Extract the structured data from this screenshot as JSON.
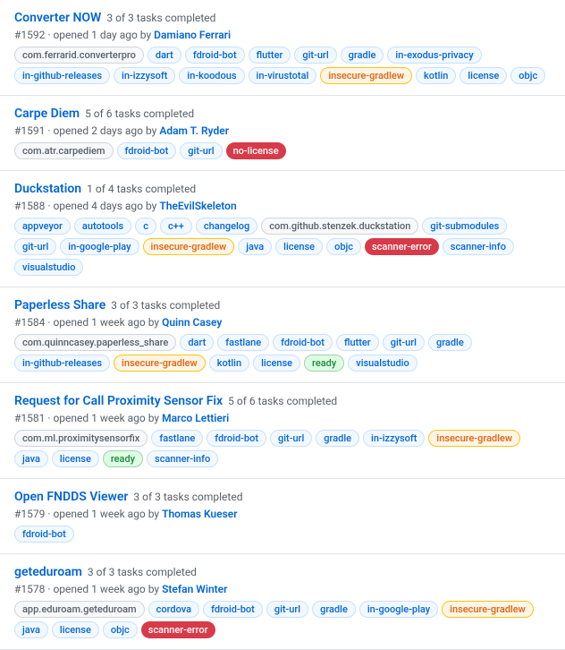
{
  "issues": [
    {
      "id": "converter-now",
      "title": "Converter NOW",
      "task_count": "3 of 3 tasks completed",
      "number": "#1592",
      "meta": "opened 1 day ago by",
      "author": "Damiano Ferrari",
      "tags": [
        {
          "label": "com.ferrarid.converterpro",
          "style": "gray"
        },
        {
          "label": "dart",
          "style": "light-blue"
        },
        {
          "label": "fdroid-bot",
          "style": "light-blue"
        },
        {
          "label": "flutter",
          "style": "light-blue"
        },
        {
          "label": "git-url",
          "style": "light-blue"
        },
        {
          "label": "gradle",
          "style": "light-blue"
        },
        {
          "label": "in-exodus-privacy",
          "style": "light-blue"
        },
        {
          "label": "in-github-releases",
          "style": "light-blue"
        },
        {
          "label": "in-izzysoft",
          "style": "light-blue"
        },
        {
          "label": "in-koodous",
          "style": "light-blue"
        },
        {
          "label": "in-virustotal",
          "style": "light-blue"
        },
        {
          "label": "insecure-gradlew",
          "style": "orange"
        },
        {
          "label": "kotlin",
          "style": "light-blue"
        },
        {
          "label": "license",
          "style": "light-blue"
        },
        {
          "label": "objc",
          "style": "light-blue"
        }
      ]
    },
    {
      "id": "carpe-diem",
      "title": "Carpe Diem",
      "task_count": "5 of 6 tasks completed",
      "number": "#1591",
      "meta": "opened 2 days ago by",
      "author": "Adam T. Ryder",
      "tags": [
        {
          "label": "com.atr.carpediem",
          "style": "gray"
        },
        {
          "label": "fdroid-bot",
          "style": "light-blue"
        },
        {
          "label": "git-url",
          "style": "light-blue"
        },
        {
          "label": "no-license",
          "style": "red"
        }
      ]
    },
    {
      "id": "duckstation",
      "title": "Duckstation",
      "task_count": "1 of 4 tasks completed",
      "number": "#1588",
      "meta": "opened 4 days ago by",
      "author": "TheEvilSkeleton",
      "tags": [
        {
          "label": "appveyor",
          "style": "light-blue"
        },
        {
          "label": "autotools",
          "style": "light-blue"
        },
        {
          "label": "c",
          "style": "light-blue"
        },
        {
          "label": "c++",
          "style": "light-blue"
        },
        {
          "label": "changelog",
          "style": "light-blue"
        },
        {
          "label": "com.github.stenzek.duckstation",
          "style": "gray"
        },
        {
          "label": "git-submodules",
          "style": "light-blue"
        },
        {
          "label": "git-url",
          "style": "light-blue"
        },
        {
          "label": "in-google-play",
          "style": "light-blue"
        },
        {
          "label": "insecure-gradlew",
          "style": "orange"
        },
        {
          "label": "java",
          "style": "light-blue"
        },
        {
          "label": "license",
          "style": "light-blue"
        },
        {
          "label": "objc",
          "style": "light-blue"
        },
        {
          "label": "scanner-error",
          "style": "red"
        },
        {
          "label": "scanner-info",
          "style": "light-blue"
        },
        {
          "label": "visualstudio",
          "style": "light-blue"
        }
      ]
    },
    {
      "id": "paperless-share",
      "title": "Paperless Share",
      "task_count": "3 of 3 tasks completed",
      "number": "#1584",
      "meta": "opened 1 week ago by",
      "author": "Quinn Casey",
      "tags": [
        {
          "label": "com.quinncasey.paperless_share",
          "style": "gray"
        },
        {
          "label": "dart",
          "style": "light-blue"
        },
        {
          "label": "fastlane",
          "style": "light-blue"
        },
        {
          "label": "fdroid-bot",
          "style": "light-blue"
        },
        {
          "label": "flutter",
          "style": "light-blue"
        },
        {
          "label": "git-url",
          "style": "light-blue"
        },
        {
          "label": "gradle",
          "style": "light-blue"
        },
        {
          "label": "in-github-releases",
          "style": "light-blue"
        },
        {
          "label": "insecure-gradlew",
          "style": "orange"
        },
        {
          "label": "kotlin",
          "style": "light-blue"
        },
        {
          "label": "license",
          "style": "light-blue"
        },
        {
          "label": "ready",
          "style": "green"
        },
        {
          "label": "visualstudio",
          "style": "light-blue"
        }
      ]
    },
    {
      "id": "request-call-proximity",
      "title": "Request for Call Proximity Sensor Fix",
      "task_count": "5 of 6 tasks completed",
      "number": "#1581",
      "meta": "opened 1 week ago by",
      "author": "Marco Lettieri",
      "tags": [
        {
          "label": "com.ml.proximitysensorfix",
          "style": "gray"
        },
        {
          "label": "fastlane",
          "style": "light-blue"
        },
        {
          "label": "fdroid-bot",
          "style": "light-blue"
        },
        {
          "label": "git-url",
          "style": "light-blue"
        },
        {
          "label": "gradle",
          "style": "light-blue"
        },
        {
          "label": "in-izzysoft",
          "style": "light-blue"
        },
        {
          "label": "insecure-gradlew",
          "style": "orange"
        },
        {
          "label": "java",
          "style": "light-blue"
        },
        {
          "label": "license",
          "style": "light-blue"
        },
        {
          "label": "ready",
          "style": "green"
        },
        {
          "label": "scanner-info",
          "style": "light-blue"
        }
      ]
    },
    {
      "id": "open-fndds-viewer",
      "title": "Open FNDDS Viewer",
      "task_count": "3 of 3 tasks completed",
      "number": "#1579",
      "meta": "opened 1 week ago by",
      "author": "Thomas Kueser",
      "tags": [
        {
          "label": "fdroid-bot",
          "style": "light-blue"
        }
      ]
    },
    {
      "id": "geteduroam",
      "title": "geteduroam",
      "task_count": "3 of 3 tasks completed",
      "number": "#1578",
      "meta": "opened 1 week ago by",
      "author": "Stefan Winter",
      "tags": [
        {
          "label": "app.eduroam.geteduroam",
          "style": "gray"
        },
        {
          "label": "cordova",
          "style": "light-blue"
        },
        {
          "label": "fdroid-bot",
          "style": "light-blue"
        },
        {
          "label": "git-url",
          "style": "light-blue"
        },
        {
          "label": "gradle",
          "style": "light-blue"
        },
        {
          "label": "in-google-play",
          "style": "light-blue"
        },
        {
          "label": "insecure-gradlew",
          "style": "orange"
        },
        {
          "label": "java",
          "style": "light-blue"
        },
        {
          "label": "license",
          "style": "light-blue"
        },
        {
          "label": "objc",
          "style": "light-blue"
        },
        {
          "label": "scanner-error",
          "style": "red"
        }
      ]
    }
  ]
}
